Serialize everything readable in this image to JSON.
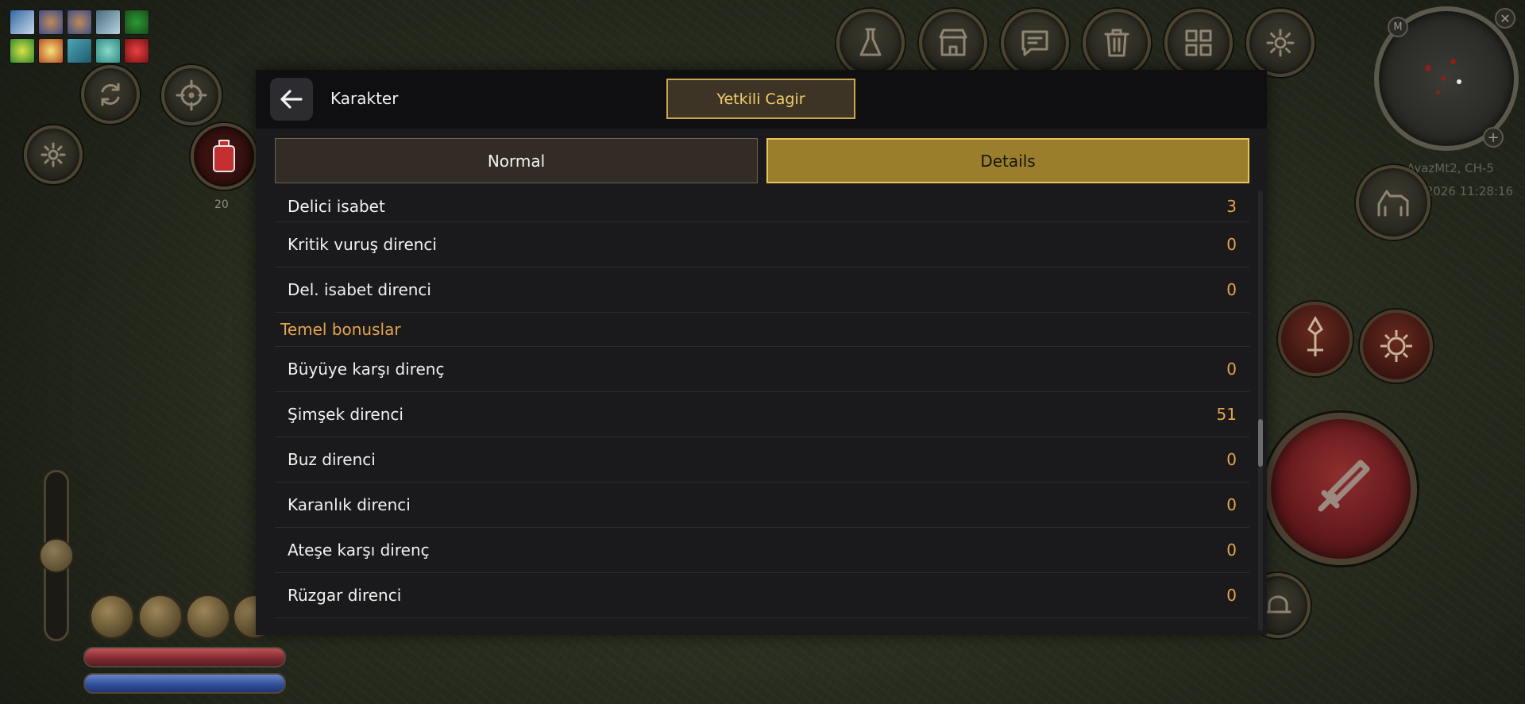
{
  "panel": {
    "title": "Karakter",
    "call_button": "Yetkili Cagir"
  },
  "tabs": [
    {
      "label": "Normal",
      "active": false
    },
    {
      "label": "Details",
      "active": true
    }
  ],
  "stats": {
    "rows_top": [
      {
        "label": "Delici isabet",
        "value": "3"
      },
      {
        "label": "Kritik vuruş direnci",
        "value": "0"
      },
      {
        "label": "Del. isabet direnci",
        "value": "0"
      }
    ],
    "section_title": "Temel bonuslar",
    "rows_bottom": [
      {
        "label": "Büyüye karşı direnç",
        "value": "0"
      },
      {
        "label": "Şimşek direnci",
        "value": "51"
      },
      {
        "label": "Buz direnci",
        "value": "0"
      },
      {
        "label": "Karanlık direnci",
        "value": "0"
      },
      {
        "label": "Ateşe karşı direnç",
        "value": "0"
      },
      {
        "label": "Rüzgar direnci",
        "value": "0"
      }
    ]
  },
  "hud": {
    "server_name": "AyazMt2, CH-5",
    "datetime": "29.08.2026 11:28:16",
    "potion_count": "20",
    "minimap_label": "M"
  },
  "colors": {
    "accent_gold": "#e8c45c",
    "value_orange": "#e6a24b",
    "panel_bg": "#1a1a1d"
  }
}
